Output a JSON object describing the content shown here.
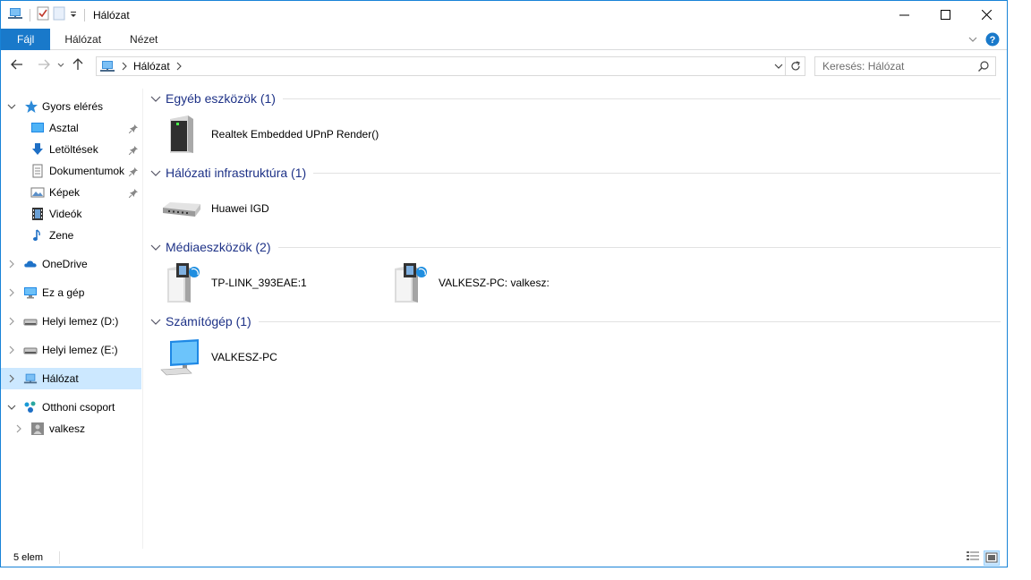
{
  "window": {
    "title": "Hálózat"
  },
  "ribbon": {
    "tabs": [
      "Fájl",
      "Hálózat",
      "Nézet"
    ]
  },
  "address": {
    "root": "Hálózat",
    "search_placeholder": "Keresés: Hálózat"
  },
  "nav": {
    "items": [
      {
        "label": "Gyors elérés",
        "icon": "star-icon"
      },
      {
        "label": "Asztal",
        "icon": "desktop-icon",
        "pinned": true
      },
      {
        "label": "Letöltések",
        "icon": "download-icon",
        "pinned": true
      },
      {
        "label": "Dokumentumok",
        "icon": "documents-icon",
        "pinned": true
      },
      {
        "label": "Képek",
        "icon": "pictures-icon",
        "pinned": true
      },
      {
        "label": "Videók",
        "icon": "videos-icon"
      },
      {
        "label": "Zene",
        "icon": "music-icon"
      },
      {
        "label": "OneDrive",
        "icon": "cloud-icon"
      },
      {
        "label": "Ez a gép",
        "icon": "computer-icon"
      },
      {
        "label": "Helyi lemez (D:)",
        "icon": "drive-icon"
      },
      {
        "label": "Helyi lemez (E:)",
        "icon": "drive-icon"
      },
      {
        "label": "Hálózat",
        "icon": "network-icon",
        "selected": true
      },
      {
        "label": "Otthoni csoport",
        "icon": "homegroup-icon"
      },
      {
        "label": "valkesz",
        "icon": "user-icon"
      }
    ]
  },
  "groups": [
    {
      "title": "Egyéb eszközök (1)",
      "items": [
        {
          "name": "Realtek Embedded UPnP Render()",
          "icon": "upnp-device-icon"
        }
      ]
    },
    {
      "title": "Hálózati infrastruktúra (1)",
      "items": [
        {
          "name": "Huawei IGD",
          "icon": "router-icon"
        }
      ]
    },
    {
      "title": "Médiaeszközök (2)",
      "items": [
        {
          "name": "TP-LINK_393EAE:1",
          "icon": "media-server-icon"
        },
        {
          "name": "VALKESZ-PC: valkesz:",
          "icon": "media-server-icon"
        }
      ]
    },
    {
      "title": "Számítógép (1)",
      "items": [
        {
          "name": "VALKESZ-PC",
          "icon": "computer-icon"
        }
      ]
    }
  ],
  "status": {
    "count": "5 elem"
  },
  "colors": {
    "accent": "#1979ca",
    "group_title": "#1e3287",
    "selected_bg": "#cce8ff"
  }
}
